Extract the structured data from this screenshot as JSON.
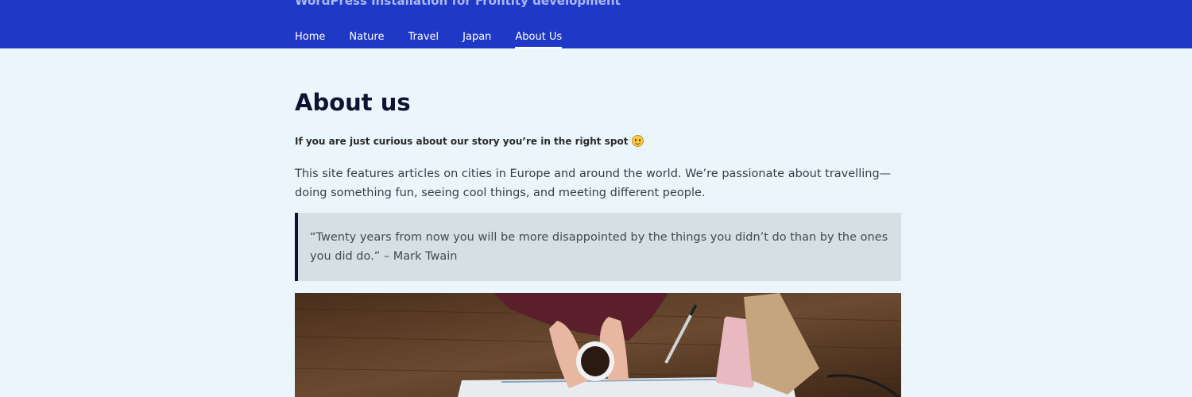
{
  "header": {
    "tagline": "WordPress Installation for Frontity development",
    "nav": [
      {
        "label": "Home"
      },
      {
        "label": "Nature"
      },
      {
        "label": "Travel"
      },
      {
        "label": "Japan"
      },
      {
        "label": "About Us",
        "active": true
      }
    ],
    "colors": {
      "background": "#1f38c5",
      "nav_text": "#ffffff"
    }
  },
  "page": {
    "title": "About us",
    "lead": "If you are just curious about our story you’re in the right spot",
    "lead_icon": "smiley-emoji-icon",
    "body": "This site features articles on cities in Europe and around the world. We’re passionate about travelling— doing something fun, seeing cool things, and meeting different people.",
    "quote": "“Twenty years from now you will be more disappointed by the things you didn’t do than by the ones you did do.” – Mark Twain",
    "image_subject": "hands holding coffee cup over a map on a wooden desk with pen, notebook and folder"
  },
  "theme": {
    "page_background": "#eaf6fb",
    "quote_background": "#d6dfe3",
    "quote_border": "#0d1330"
  }
}
